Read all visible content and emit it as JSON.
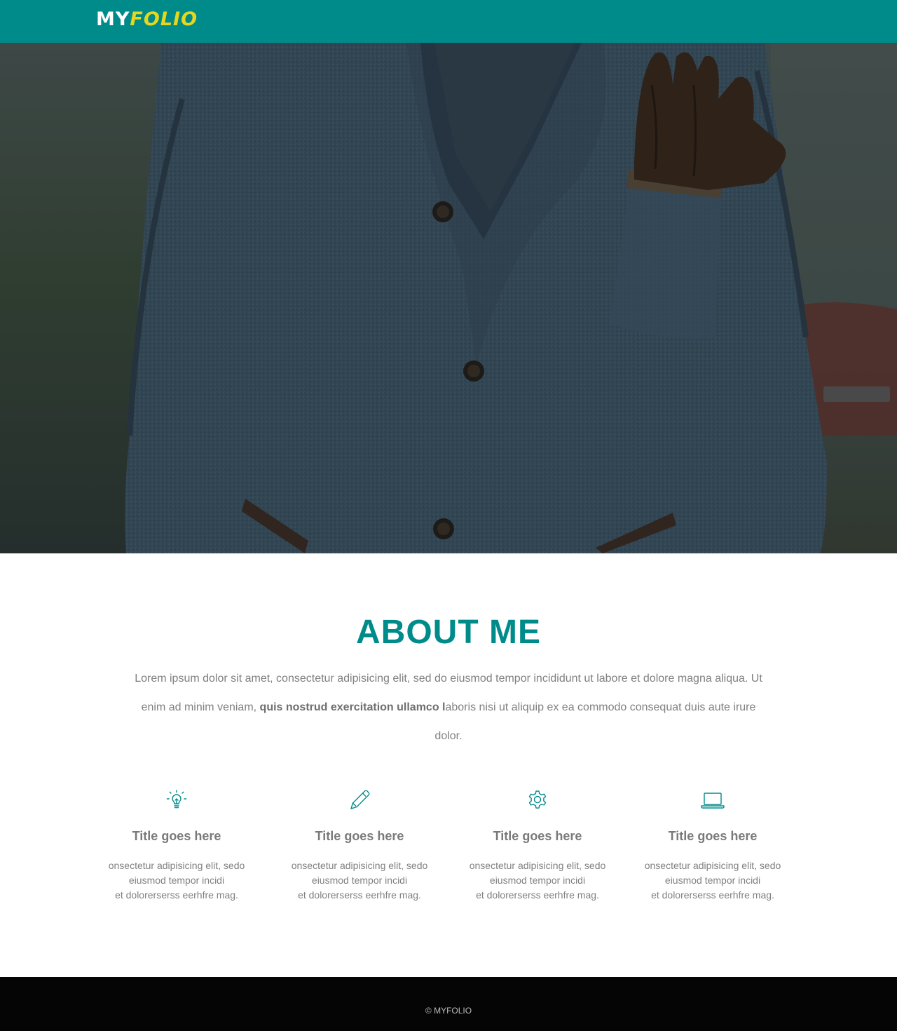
{
  "brand": {
    "logo_part1": "MY",
    "logo_part2": "FOLIO"
  },
  "colors": {
    "accent": "#008b8b",
    "logo_highlight": "#e6d61c",
    "footer_bg": "#050505"
  },
  "hero": {
    "image": "man-in-gray-wool-coat-with-leather-gloves-in-pocket"
  },
  "about": {
    "title": "ABOUT ME",
    "text_part1": "Lorem ipsum dolor sit amet, consectetur adipisicing elit, sed do eiusmod tempor incididunt ut labore et dolore magna aliqua. Ut enim ad minim veniam, ",
    "text_bold": "quis nostrud exercitation ullamco l",
    "text_part2": "aboris nisi ut aliquip ex ea  commodo consequat duis aute irure dolor."
  },
  "features": [
    {
      "icon": "lightbulb-icon",
      "title": "Title goes here",
      "line1": "onsectetur adipisicing elit, sedo",
      "line2": "eiusmod tempor incidi",
      "line3": "et dolorerserss eerhfre mag."
    },
    {
      "icon": "pencil-icon",
      "title": "Title goes here",
      "line1": "onsectetur adipisicing elit, sedo",
      "line2": "eiusmod tempor incidi",
      "line3": "et dolorerserss eerhfre mag."
    },
    {
      "icon": "gear-icon",
      "title": "Title goes here",
      "line1": "onsectetur adipisicing elit, sedo",
      "line2": "eiusmod tempor incidi",
      "line3": "et dolorerserss eerhfre mag."
    },
    {
      "icon": "laptop-icon",
      "title": "Title goes here",
      "line1": "onsectetur adipisicing elit, sedo",
      "line2": "eiusmod tempor incidi",
      "line3": "et dolorerserss eerhfre mag."
    }
  ],
  "footer": {
    "copyright": "© MYFOLIO"
  }
}
